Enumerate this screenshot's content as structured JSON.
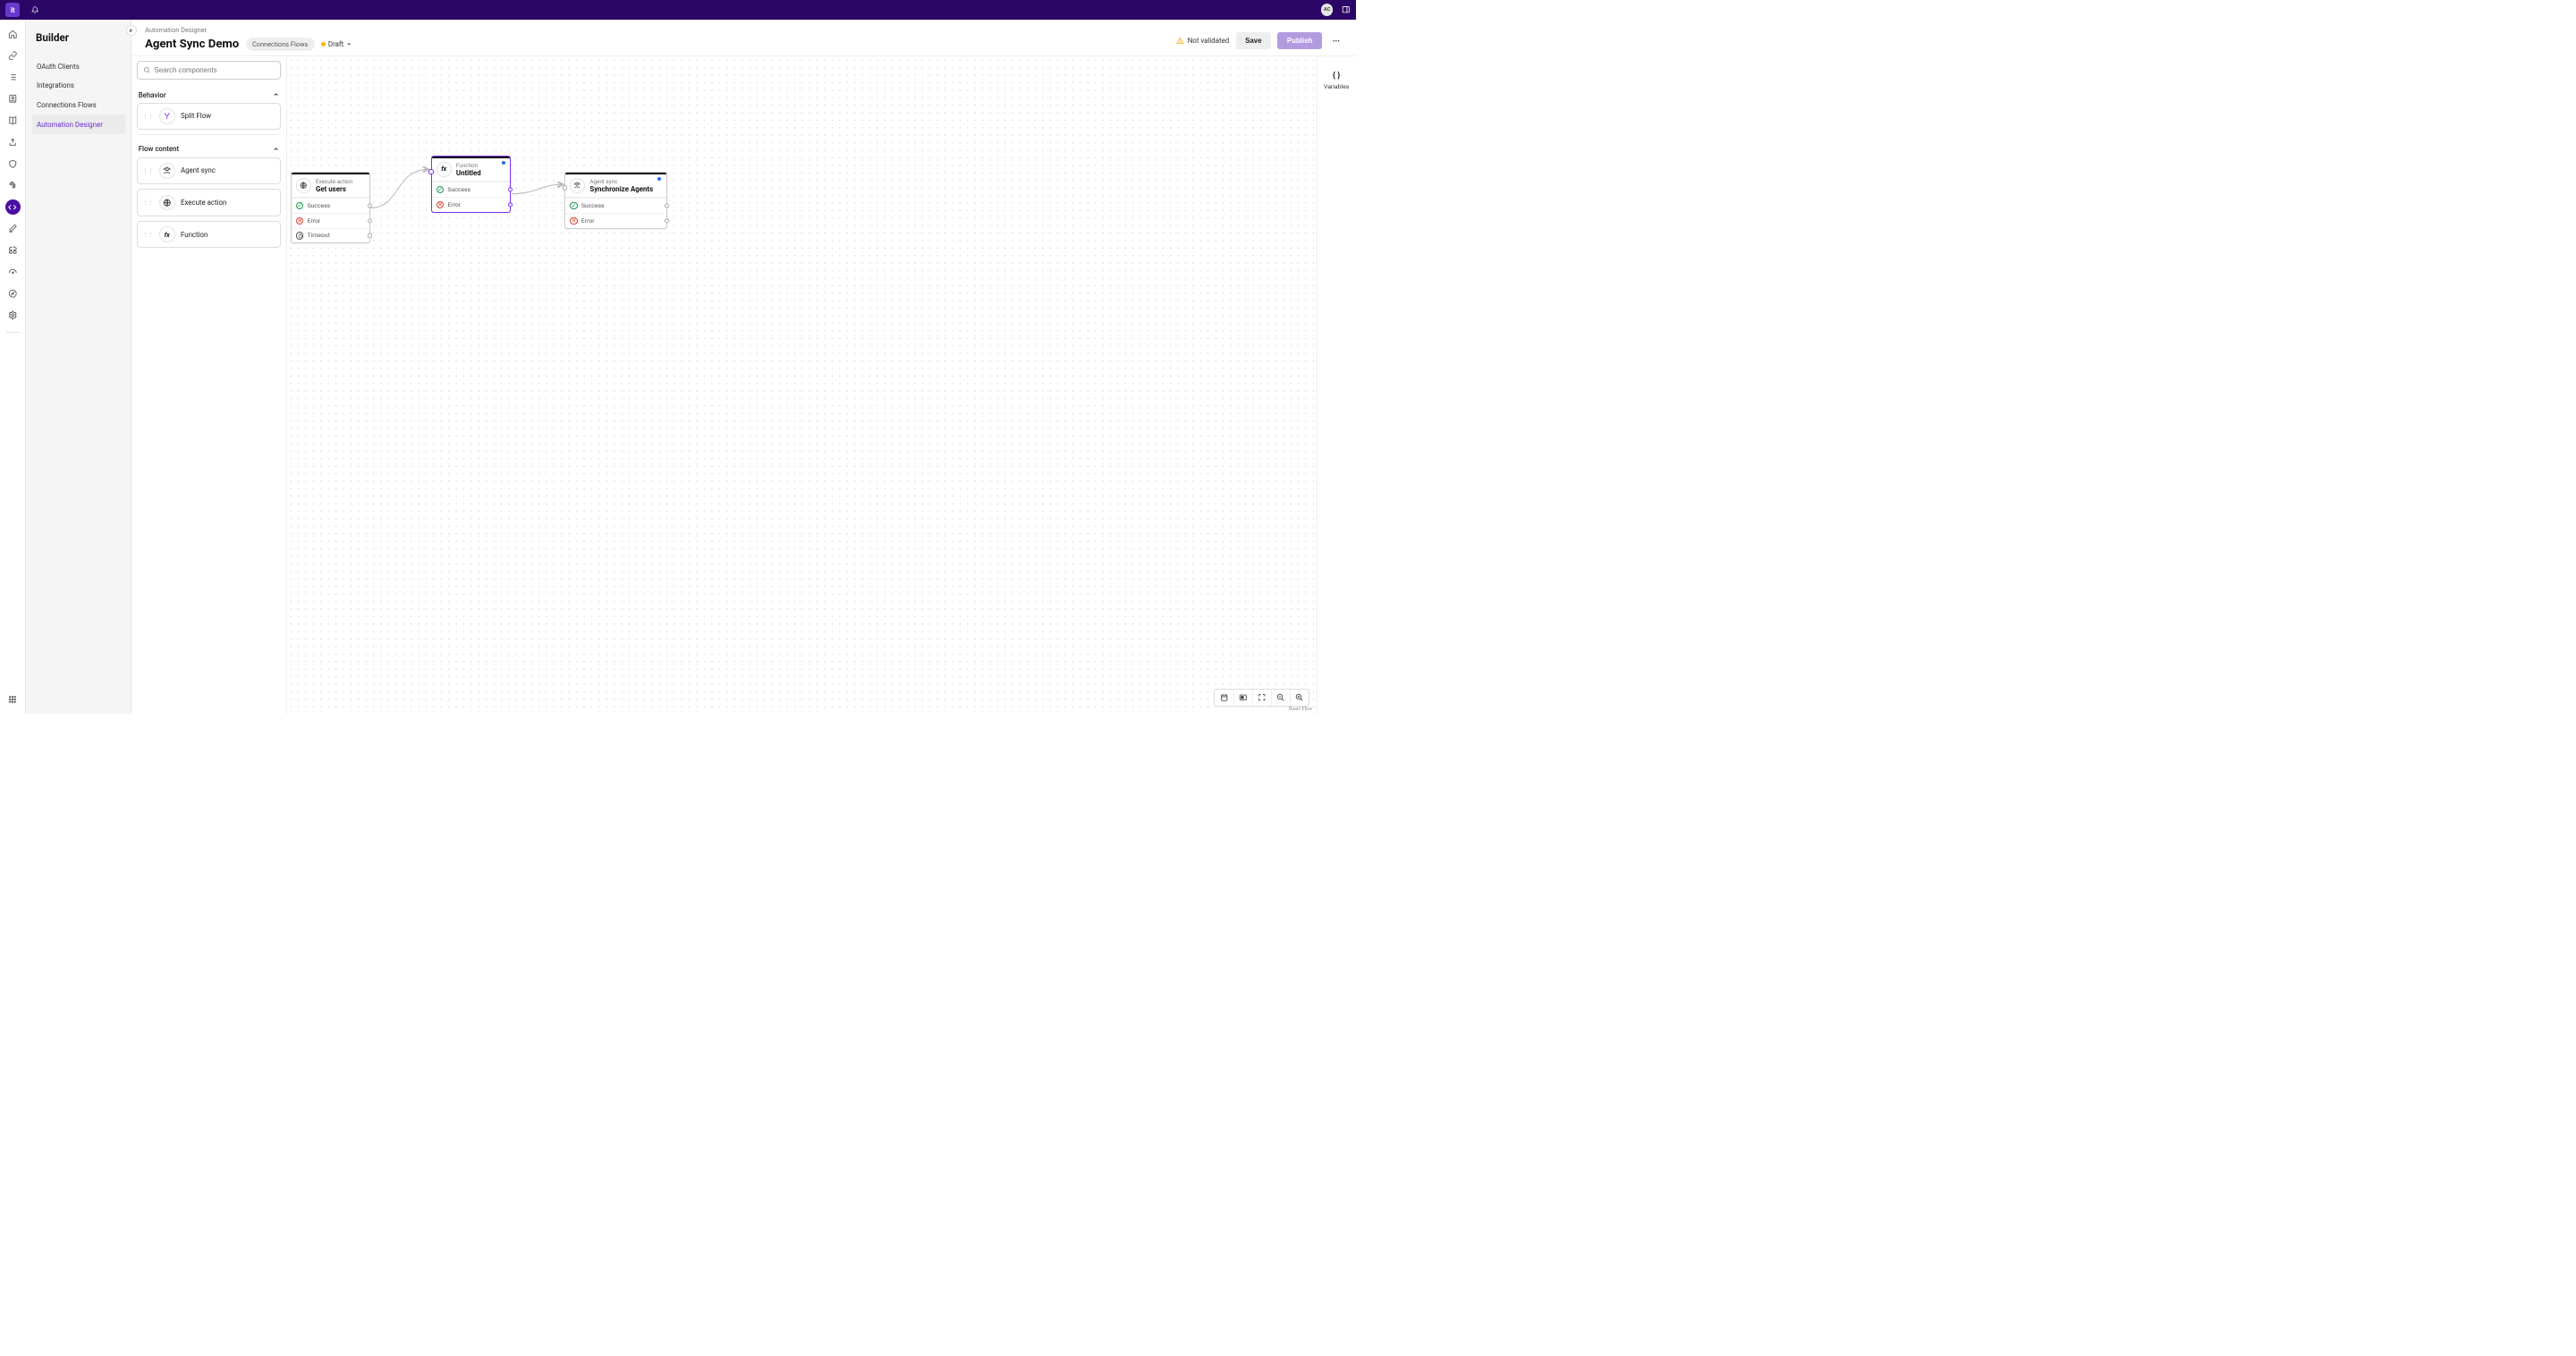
{
  "topbar": {
    "logo_text": "it",
    "avatar": "AC"
  },
  "sidebar": {
    "heading": "Builder",
    "items": [
      {
        "label": "OAuth Clients"
      },
      {
        "label": "Integrations"
      },
      {
        "label": "Connections Flows"
      },
      {
        "label": "Automation Designer",
        "active": true
      }
    ]
  },
  "header": {
    "breadcrumb": "Automation Designer",
    "title": "Agent Sync Demo",
    "tag": "Connections Flows",
    "status_label": "Draft",
    "not_validated": "Not validated",
    "save": "Save",
    "publish": "Publish"
  },
  "palette": {
    "search_placeholder": "Search components",
    "section_behavior": "Behavior",
    "section_flow_content": "Flow content",
    "behavior_items": [
      {
        "label": "Split Flow",
        "icon": "split"
      }
    ],
    "flow_items": [
      {
        "label": "Agent sync",
        "icon": "agent"
      },
      {
        "label": "Execute action",
        "icon": "globe"
      },
      {
        "label": "Function",
        "icon": "fx"
      }
    ]
  },
  "right_rail": {
    "variables": "Variables",
    "braces": "{ }"
  },
  "canvas": {
    "attribution": "React Flow",
    "nodes": [
      {
        "id": "n1",
        "type_label": "Execute action",
        "title": "Get users",
        "icon": "globe",
        "rows": [
          {
            "label": "Success",
            "status": "success"
          },
          {
            "label": "Error",
            "status": "error"
          },
          {
            "label": "Timeout",
            "status": "timeout"
          }
        ]
      },
      {
        "id": "n2",
        "type_label": "Function",
        "title": "Untitled",
        "icon": "fx",
        "selected": true,
        "changed": true,
        "rows": [
          {
            "label": "Success",
            "status": "success"
          },
          {
            "label": "Error",
            "status": "error"
          }
        ]
      },
      {
        "id": "n3",
        "type_label": "Agent sync",
        "title": "Synchronize Agents",
        "icon": "agent",
        "changed": true,
        "rows": [
          {
            "label": "Success",
            "status": "success"
          },
          {
            "label": "Error",
            "status": "error"
          }
        ]
      }
    ]
  }
}
